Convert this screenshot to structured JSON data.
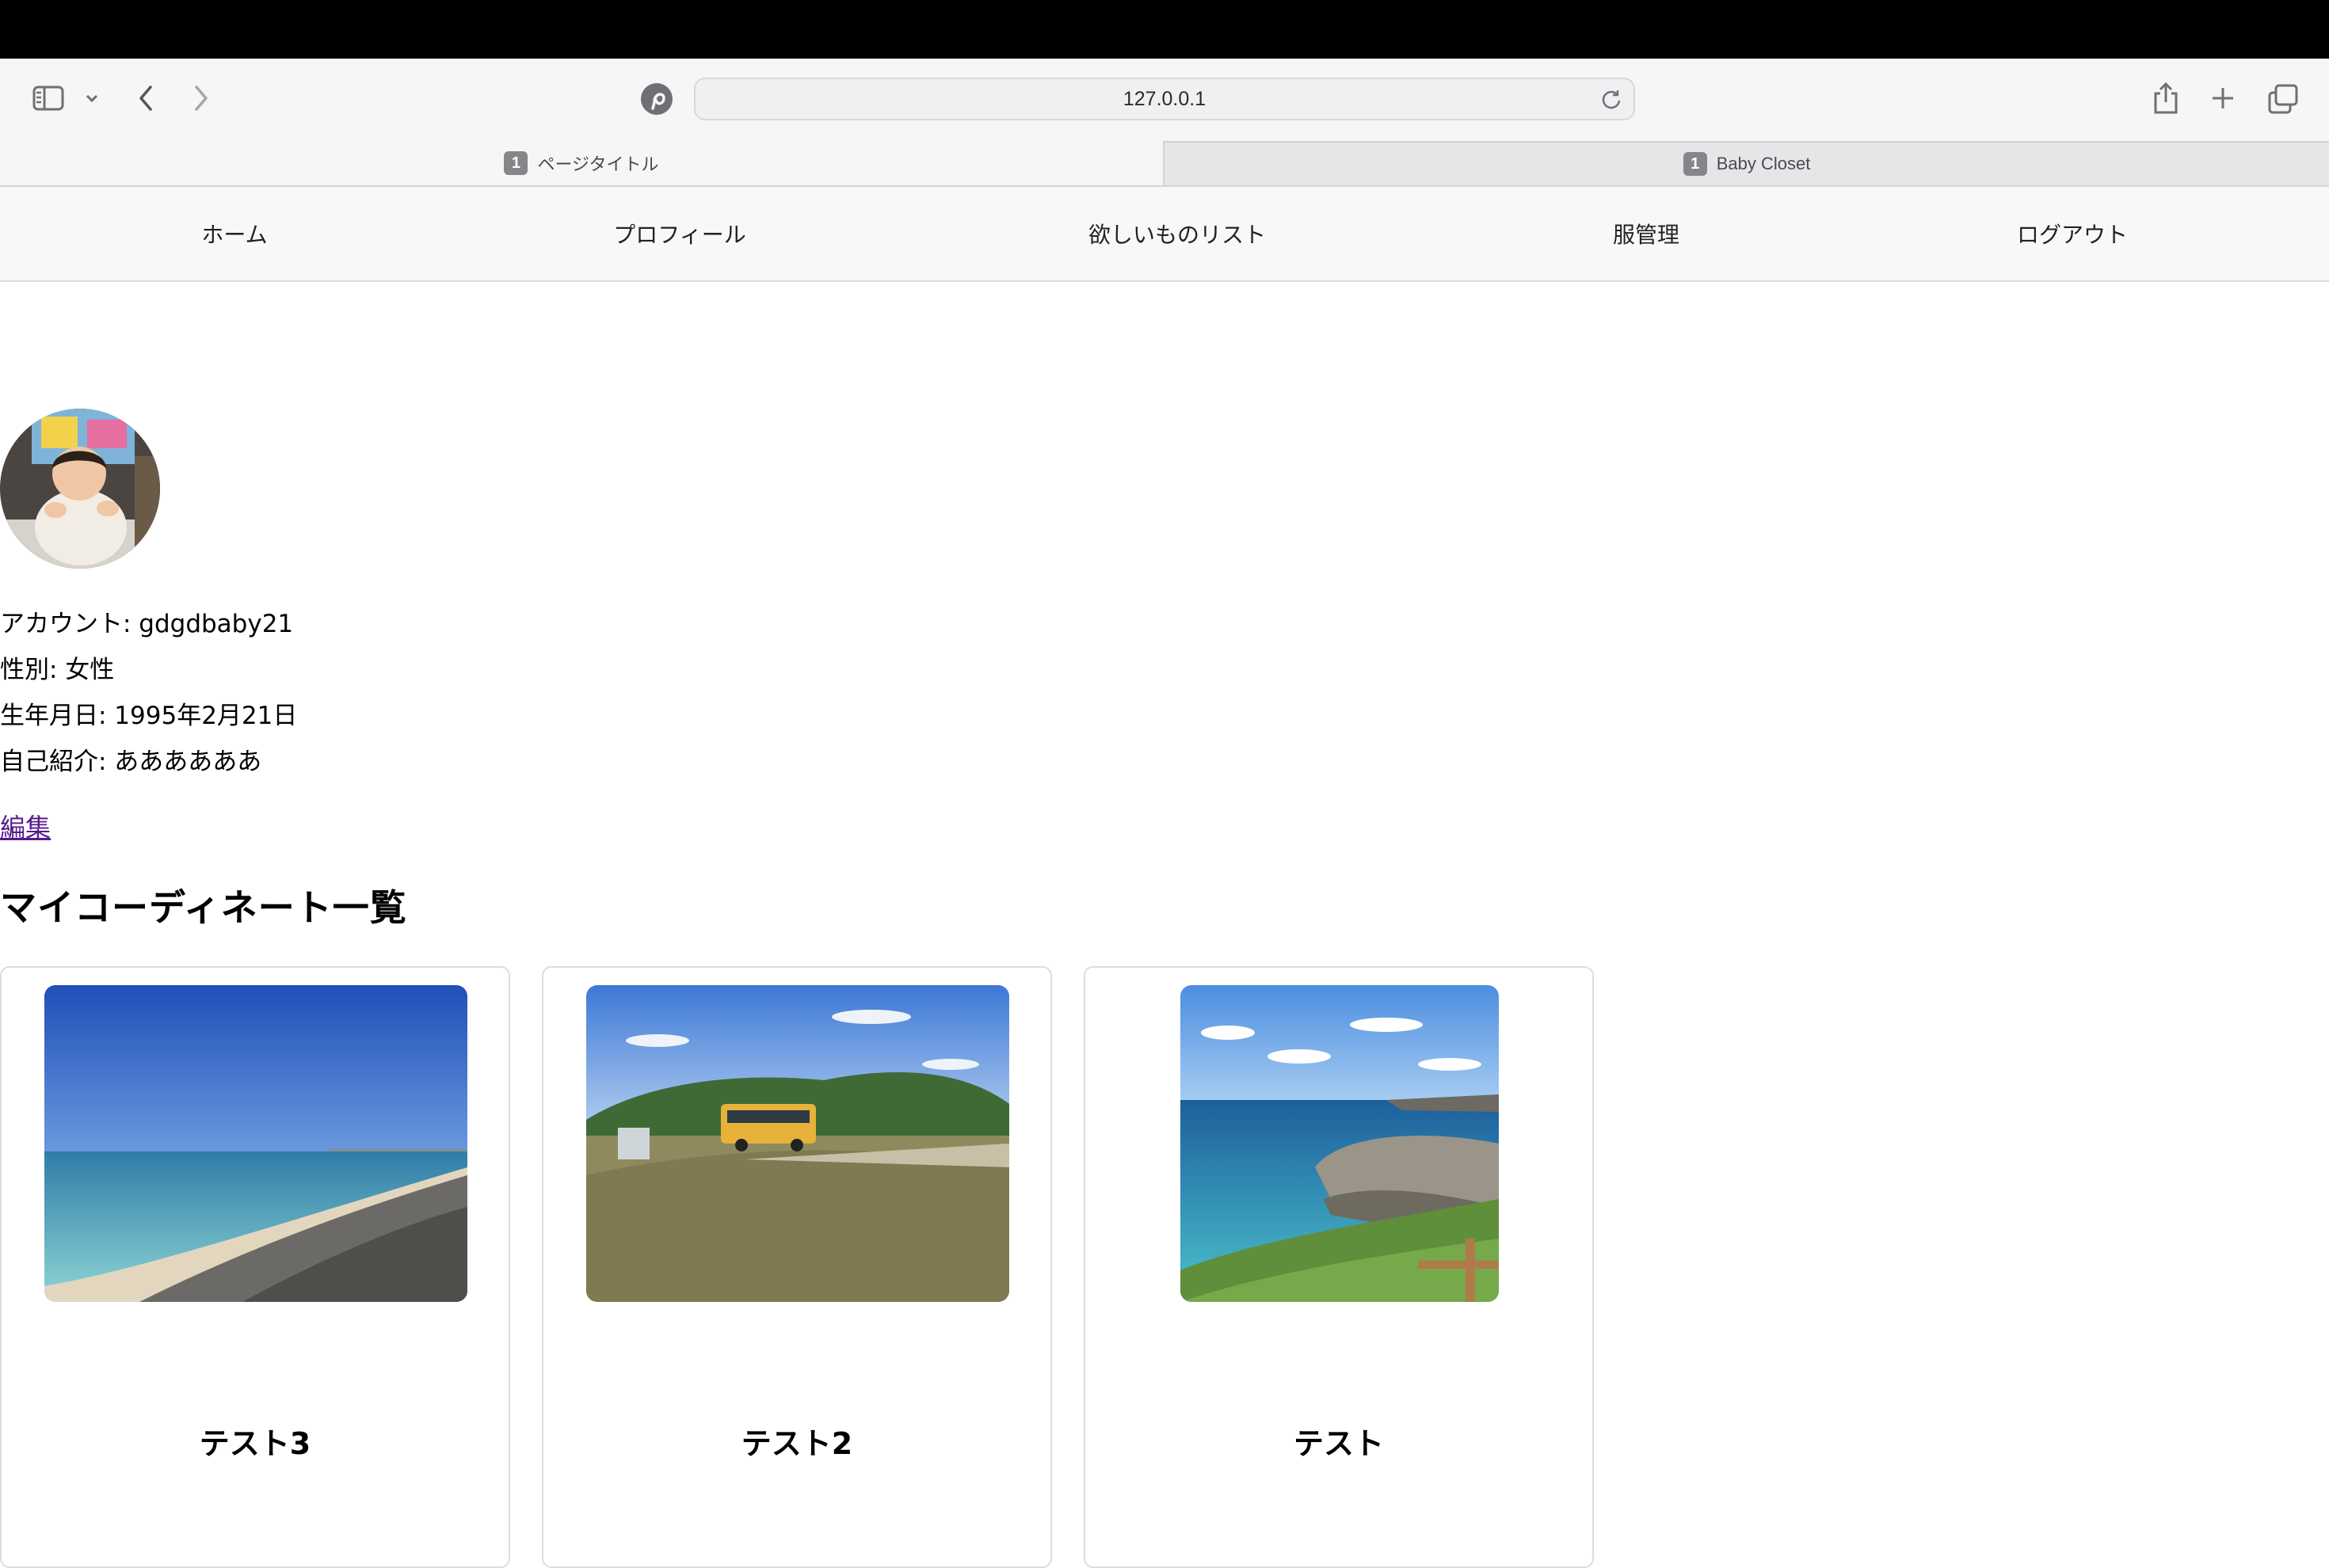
{
  "browser": {
    "url": "127.0.0.1",
    "tabs": [
      {
        "badge": "1",
        "title": "ページタイトル",
        "active": true
      },
      {
        "badge": "1",
        "title": "Baby Closet",
        "active": false
      }
    ]
  },
  "nav": {
    "items": [
      "ホーム",
      "プロフィール",
      "欲しいものリスト",
      "服管理",
      "ログアウト"
    ]
  },
  "profile": {
    "account": "アカウント: gdgdbaby21",
    "gender": "性別: 女性",
    "birthday": "生年月日: 1995年2月21日",
    "bio": "自己紹介: ああああああ",
    "edit_label": "編集"
  },
  "coordinates": {
    "heading": "マイコーディネート一覧",
    "cards": [
      {
        "title": "テスト3",
        "image": "beach-photo"
      },
      {
        "title": "テスト2",
        "image": "park-bus-photo"
      },
      {
        "title": "テスト",
        "image": "coast-rocks-photo"
      }
    ]
  },
  "icons": [
    "sidebar-icon",
    "chevron-down-icon",
    "back-icon",
    "forward-icon",
    "pinterest-icon",
    "reload-icon",
    "share-icon",
    "plus-icon",
    "tabs-overview-icon"
  ],
  "colors": {
    "link": "#551a8b",
    "nav_bg": "#f8f8f8",
    "chrome_bg": "#f6f6f7"
  }
}
